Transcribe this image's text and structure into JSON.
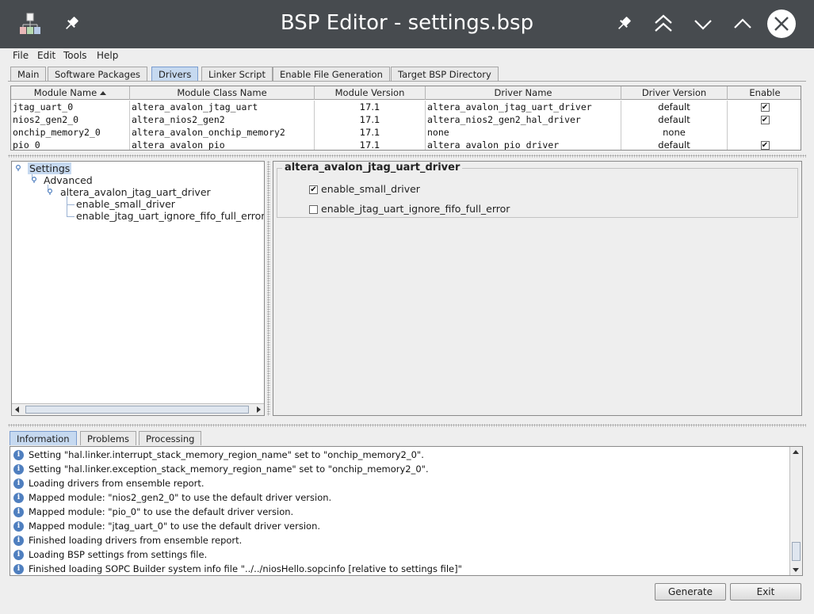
{
  "window": {
    "title": "BSP Editor - settings.bsp"
  },
  "titlebar_icons": [
    "app-tree-icon",
    "pin-icon",
    "pin-icon",
    "double-chevron-up-icon",
    "chevron-down-icon",
    "chevron-up-icon",
    "close-icon"
  ],
  "menu": [
    "File",
    "Edit",
    "Tools",
    "Help"
  ],
  "tabs": [
    "Main",
    "Software Packages",
    "Drivers",
    "Linker Script",
    "Enable File Generation",
    "Target BSP Directory"
  ],
  "active_tab": "Drivers",
  "drivers_table": {
    "headers": [
      "Module Name",
      "Module Class Name",
      "Module Version",
      "Driver Name",
      "Driver Version",
      "Enable"
    ],
    "sorted_by": "Module Name",
    "rows": [
      {
        "module": "jtag_uart_0",
        "class": "altera_avalon_jtag_uart",
        "version": "17.1",
        "driver": "altera_avalon_jtag_uart_driver",
        "driver_version": "default",
        "enabled": true
      },
      {
        "module": "nios2_gen2_0",
        "class": "altera_nios2_gen2",
        "version": "17.1",
        "driver": "altera_nios2_gen2_hal_driver",
        "driver_version": "default",
        "enabled": true
      },
      {
        "module": "onchip_memory2_0",
        "class": "altera_avalon_onchip_memory2",
        "version": "17.1",
        "driver": "none",
        "driver_version": "none",
        "enabled": null
      },
      {
        "module": "pio_0",
        "class": "altera_avalon_pio",
        "version": "17.1",
        "driver": "altera_avalon_pio_driver",
        "driver_version": "default",
        "enabled": true
      }
    ]
  },
  "tree": {
    "root": "Settings",
    "advanced": "Advanced",
    "driver": "altera_avalon_jtag_uart_driver",
    "leaf1": "enable_small_driver",
    "leaf2": "enable_jtag_uart_ignore_fifo_full_error"
  },
  "detail": {
    "group_title": "altera_avalon_jtag_uart_driver",
    "options": [
      {
        "label": "enable_small_driver",
        "checked": true
      },
      {
        "label": "enable_jtag_uart_ignore_fifo_full_error",
        "checked": false
      }
    ]
  },
  "bottom_tabs": [
    "Information",
    "Problems",
    "Processing"
  ],
  "active_bottom_tab": "Information",
  "log": [
    "Setting \"hal.linker.interrupt_stack_memory_region_name\" set to \"onchip_memory2_0\".",
    "Setting \"hal.linker.exception_stack_memory_region_name\" set to \"onchip_memory2_0\".",
    "Loading drivers from ensemble report.",
    "Mapped module: \"nios2_gen2_0\" to use the default driver version.",
    "Mapped module: \"pio_0\" to use the default driver version.",
    "Mapped module: \"jtag_uart_0\" to use the default driver version.",
    "Finished loading drivers from ensemble report.",
    "Loading BSP settings from settings file.",
    "Finished loading SOPC Builder system info file \"../../niosHello.sopcinfo [relative to settings file]\""
  ],
  "buttons": {
    "generate": "Generate",
    "exit": "Exit"
  },
  "colors": {
    "titlebar": "#474b4f",
    "selection": "#c6d9f0",
    "info": "#4f7fbf"
  }
}
